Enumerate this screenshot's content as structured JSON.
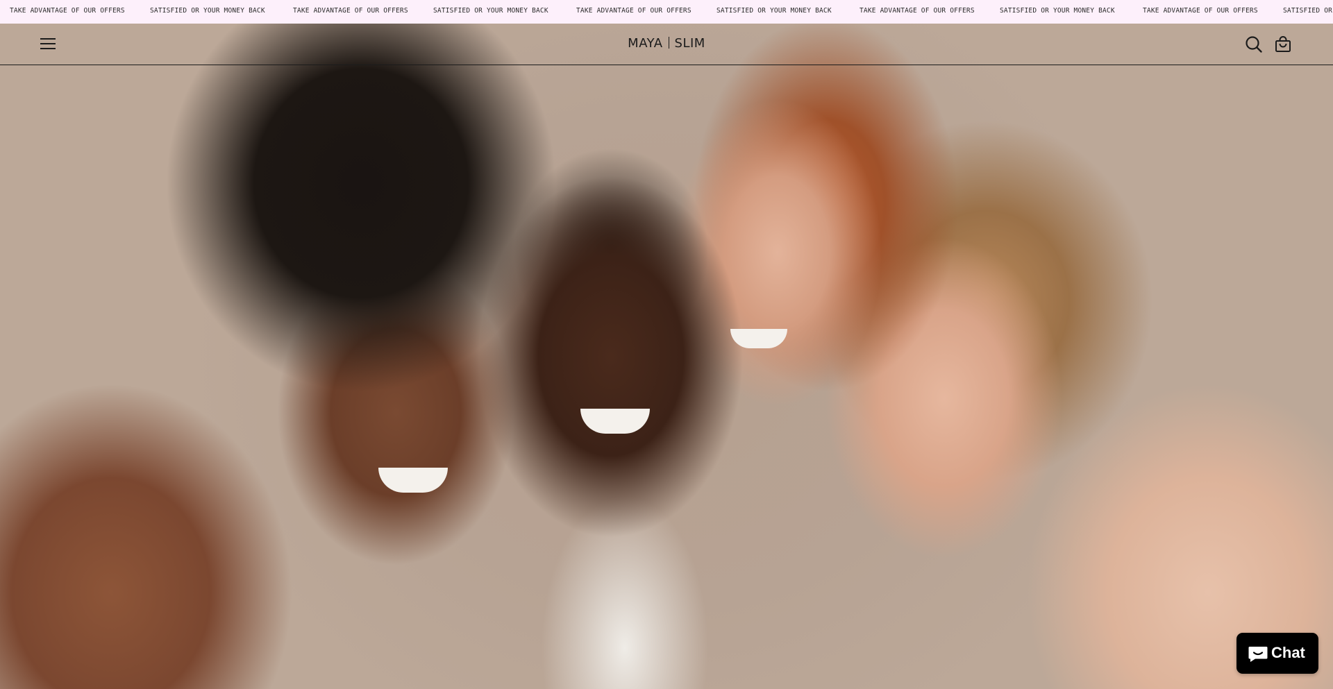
{
  "announcement": {
    "items": [
      "TAKE ADVANTAGE OF OUR OFFERS",
      "SATISFIED OR YOUR MONEY BACK",
      "TAKE ADVANTAGE OF OUR OFFERS",
      "SATISFIED OR YOUR MONEY BACK",
      "TAKE ADVANTAGE OF OUR OFFERS",
      "SATISFIED OR YOUR MONEY BACK",
      "TAKE ADVANTAGE OF OUR OFFERS",
      "SATISFIED OR YOUR MONEY BACK",
      "TAKE ADVANTAGE OF OUR OFFERS",
      "SATISFIED OR YOUR MONEY BACK"
    ],
    "background_color": "#fdf0fb"
  },
  "header": {
    "logo_left": "MAYA",
    "logo_right": "SLIM",
    "menu_icon": "hamburger-icon",
    "search_icon": "search-icon",
    "cart_icon": "shopping-bag-icon"
  },
  "chat": {
    "label": "Chat",
    "icon": "chat-bubble-icon"
  }
}
